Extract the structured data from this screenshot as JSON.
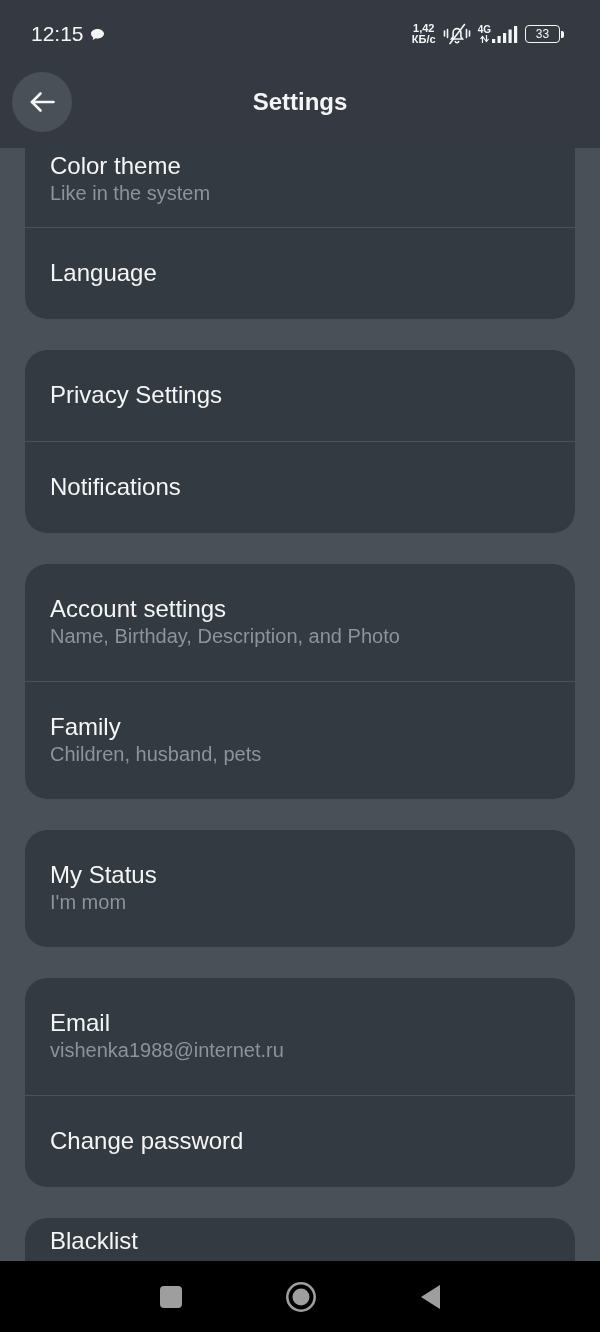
{
  "status_bar": {
    "time": "12:15",
    "speed_value": "1,42",
    "speed_unit": "КБ/с",
    "network_type": "4G",
    "battery": "33"
  },
  "header": {
    "title": "Settings"
  },
  "groups": [
    {
      "items": [
        {
          "title": "Color theme",
          "subtitle": "Like in the system"
        },
        {
          "title": "Language"
        }
      ]
    },
    {
      "items": [
        {
          "title": "Privacy Settings"
        },
        {
          "title": "Notifications"
        }
      ]
    },
    {
      "items": [
        {
          "title": "Account settings",
          "subtitle": "Name, Birthday, Description, and Photo"
        },
        {
          "title": "Family",
          "subtitle": "Children, husband, pets"
        }
      ]
    },
    {
      "items": [
        {
          "title": "My Status",
          "subtitle": "I'm mom"
        }
      ]
    },
    {
      "items": [
        {
          "title": "Email",
          "subtitle": "vishenka1988@internet.ru"
        },
        {
          "title": "Change password"
        }
      ]
    },
    {
      "items": [
        {
          "title": "Blacklist"
        }
      ]
    }
  ]
}
